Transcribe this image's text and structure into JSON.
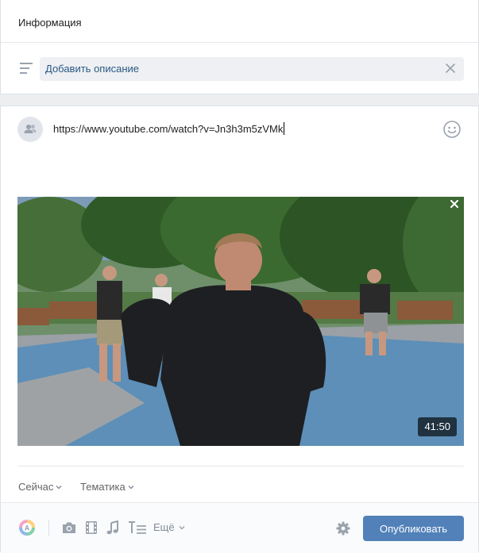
{
  "info": {
    "title": "Информация",
    "description_placeholder": "Добавить описание"
  },
  "composer": {
    "text": "https://www.youtube.com/watch?v=Jn3h3m5zVMk",
    "video": {
      "duration": "41:50"
    },
    "time_label": "Сейчас",
    "topic_label": "Тематика"
  },
  "toolbar": {
    "more_label": "Ещё",
    "publish_label": "Опубликовать"
  },
  "colors": {
    "accent": "#5181b8",
    "link": "#2a5885",
    "icon": "#99a2ad"
  },
  "icons": [
    "text-lines-icon",
    "close-icon",
    "users-icon",
    "smile-icon",
    "poster-icon",
    "camera-icon",
    "film-icon",
    "music-icon",
    "text-format-icon",
    "chevron-down-icon",
    "gear-icon"
  ]
}
